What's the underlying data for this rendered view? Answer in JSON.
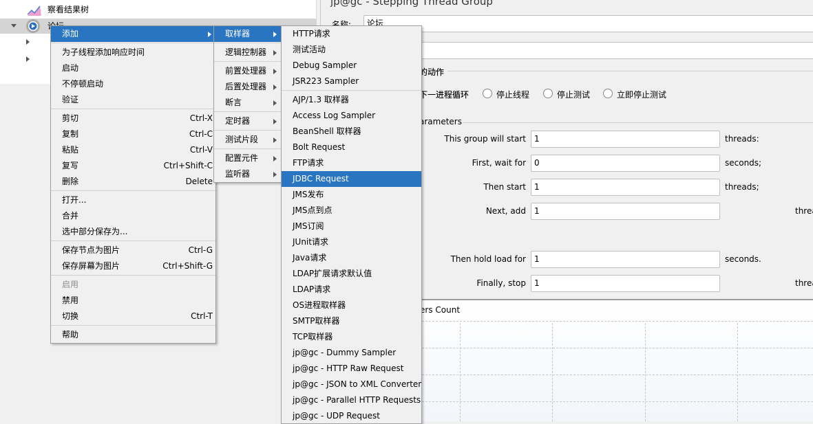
{
  "tree": {
    "items": [
      {
        "label": "察看结果树",
        "icon": "graph-icon"
      },
      {
        "label": "论坛",
        "icon": "gear-play-icon",
        "selected": true
      }
    ]
  },
  "panel": {
    "title": "jp@gc - Stepping Thread Group",
    "name_label": "名称:",
    "name_value": "论坛",
    "comment_value": "",
    "action_group_label": "在取样器错误后要执行的动作",
    "action_visible_label": "的动作",
    "radios": [
      {
        "label": "启动下一进程循环",
        "visible": "下一进程循环"
      },
      {
        "label": "停止线程"
      },
      {
        "label": "停止测试"
      },
      {
        "label": "立即停止测试"
      }
    ],
    "params_title": "arameters",
    "params": [
      {
        "label": "This group will start",
        "value": "1",
        "unit": "threads:"
      },
      {
        "label": "First, wait for",
        "value": "0",
        "unit": "seconds;"
      },
      {
        "label": "Then start",
        "value": "1",
        "unit": "threads;"
      },
      {
        "label": "Next, add",
        "value": "1",
        "unit": "threa"
      },
      {
        "label": "Then hold load for",
        "value": "1",
        "unit": "seconds."
      },
      {
        "label": "Finally, stop",
        "value": "1",
        "unit": "threa"
      }
    ],
    "chart_title": "ers Count"
  },
  "menu1": [
    {
      "label": "添加",
      "submenu": true,
      "highlighted": true
    },
    {
      "sep": true
    },
    {
      "label": "为子线程添加响应时间"
    },
    {
      "label": "启动"
    },
    {
      "label": "不停顿启动"
    },
    {
      "label": "验证"
    },
    {
      "sep": true
    },
    {
      "label": "剪切",
      "shortcut": "Ctrl-X"
    },
    {
      "label": "复制",
      "shortcut": "Ctrl-C"
    },
    {
      "label": "粘贴",
      "shortcut": "Ctrl-V"
    },
    {
      "label": "复写",
      "shortcut": "Ctrl+Shift-C"
    },
    {
      "label": "删除",
      "shortcut": "Delete"
    },
    {
      "sep": true
    },
    {
      "label": "打开..."
    },
    {
      "label": "合并"
    },
    {
      "label": "选中部分保存为..."
    },
    {
      "sep": true
    },
    {
      "label": "保存节点为图片",
      "shortcut": "Ctrl-G"
    },
    {
      "label": "保存屏幕为图片",
      "shortcut": "Ctrl+Shift-G"
    },
    {
      "sep": true
    },
    {
      "label": "启用",
      "disabled": true
    },
    {
      "label": "禁用"
    },
    {
      "label": "切换",
      "shortcut": "Ctrl-T"
    },
    {
      "sep": true
    },
    {
      "label": "帮助"
    }
  ],
  "menu2": [
    {
      "label": "取样器",
      "submenu": true,
      "highlighted": true
    },
    {
      "sep": true
    },
    {
      "label": "逻辑控制器",
      "submenu": true
    },
    {
      "sep": true
    },
    {
      "label": "前置处理器",
      "submenu": true
    },
    {
      "label": "后置处理器",
      "submenu": true
    },
    {
      "label": "断言",
      "submenu": true
    },
    {
      "sep": true
    },
    {
      "label": "定时器",
      "submenu": true
    },
    {
      "sep": true
    },
    {
      "label": "测试片段",
      "submenu": true
    },
    {
      "sep": true
    },
    {
      "label": "配置元件",
      "submenu": true
    },
    {
      "label": "监听器",
      "submenu": true
    }
  ],
  "menu3": [
    {
      "label": "HTTP请求"
    },
    {
      "label": "测试活动"
    },
    {
      "label": "Debug Sampler"
    },
    {
      "label": "JSR223 Sampler"
    },
    {
      "sep": true
    },
    {
      "label": "AJP/1.3 取样器"
    },
    {
      "label": "Access Log Sampler"
    },
    {
      "label": "BeanShell 取样器"
    },
    {
      "label": "Bolt Request"
    },
    {
      "label": "FTP请求"
    },
    {
      "label": "JDBC Request",
      "highlighted": true
    },
    {
      "label": "JMS发布"
    },
    {
      "label": "JMS点到点"
    },
    {
      "label": "JMS订阅"
    },
    {
      "label": "JUnit请求"
    },
    {
      "label": "Java请求"
    },
    {
      "label": "LDAP扩展请求默认值"
    },
    {
      "label": "LDAP请求"
    },
    {
      "label": "OS进程取样器"
    },
    {
      "label": "SMTP取样器"
    },
    {
      "label": "TCP取样器"
    },
    {
      "label": "jp@gc - Dummy Sampler"
    },
    {
      "label": "jp@gc - HTTP Raw Request"
    },
    {
      "label": "jp@gc - JSON to XML Converter"
    },
    {
      "label": "jp@gc - Parallel HTTP Requests"
    },
    {
      "label": "jp@gc - UDP Request"
    }
  ],
  "colors": {
    "highlight": "#2a75c1",
    "menu_bg": "#f0f0f0",
    "selected_row": "#d4d4d4"
  }
}
